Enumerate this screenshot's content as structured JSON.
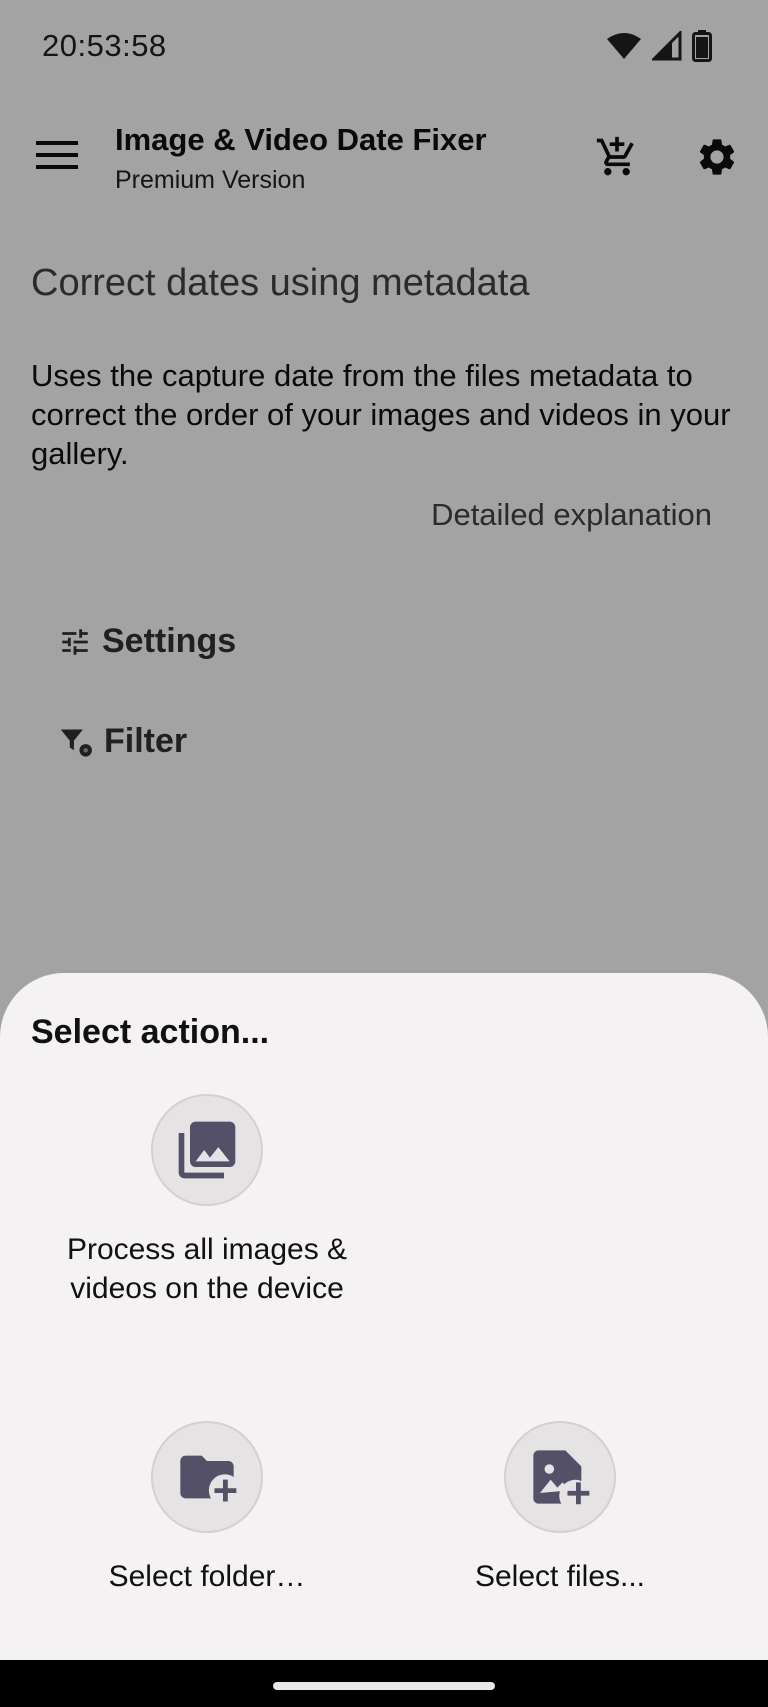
{
  "status_bar": {
    "time": "20:53:58"
  },
  "app_bar": {
    "title": "Image & Video Date Fixer",
    "subtitle": "Premium Version"
  },
  "main": {
    "heading": "Correct dates using metadata",
    "description": "Uses the capture date from the files metadata to correct the order of your images and videos in your gallery.",
    "explanation_link": "Detailed explanation",
    "settings_label": "Settings",
    "filter_label": "Filter"
  },
  "sheet": {
    "title": "Select action...",
    "actions": [
      {
        "label": "Process all images & videos on the device",
        "icon": "photo-library-icon"
      },
      {
        "label": "Select folder…",
        "icon": "folder-add-icon"
      },
      {
        "label": "Select files...",
        "icon": "image-add-icon"
      }
    ]
  },
  "colors": {
    "scrim": "#a7a5a8",
    "sheet_background": "#f5f2f3",
    "icon_circle": "#e6e3e5",
    "icon_fill": "#545067"
  }
}
